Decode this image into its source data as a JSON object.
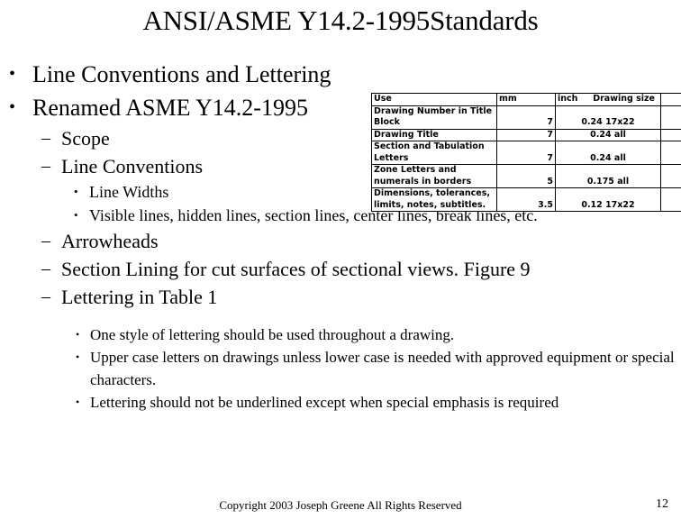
{
  "slide": {
    "title": "ANSI/ASME Y14.2-1995Standards",
    "page_number": "12",
    "copyright": "Copyright 2003 Joseph Greene All Rights Reserved"
  },
  "bullets": {
    "marker_level1": "•",
    "marker_level2": "–",
    "marker_level3": "•",
    "marker_level4": "•",
    "items": [
      {
        "level": 1,
        "text": "Line Conventions and Lettering"
      },
      {
        "level": 1,
        "text": "Renamed ASME Y14.2-1995"
      },
      {
        "level": 2,
        "text": "Scope"
      },
      {
        "level": 2,
        "text": "Line Conventions"
      },
      {
        "level": 3,
        "text": "Line Widths"
      },
      {
        "level": 3,
        "text": "Visible lines, hidden lines, section lines, center lines, break lines, etc."
      },
      {
        "level": 2,
        "text": "Arrowheads"
      },
      {
        "level": 2,
        "text": "Section Lining for cut surfaces of sectional views. Figure 9"
      },
      {
        "level": 2,
        "text": "Lettering in Table 1"
      },
      {
        "level": 4,
        "text": "One style of lettering should be used throughout a drawing."
      },
      {
        "level": 4,
        "text": "Upper case letters on drawings unless lower case is needed with approved equipment or special characters."
      },
      {
        "level": 4,
        "text": "Lettering should not be underlined except when special emphasis is required"
      }
    ]
  },
  "table": {
    "headers": {
      "use": "Use",
      "mm": "mm",
      "inch": "inch",
      "drawing_size": "Drawing size",
      "extra": ""
    },
    "rows": [
      {
        "use_line1": "Drawing Number in Title",
        "use_line2": "Block",
        "mm": "7",
        "inch": "0.24 17x22",
        "extra": ""
      },
      {
        "use_line1": "Drawing Title",
        "use_line2": "",
        "mm": "7",
        "inch": "0.24 all",
        "extra": ""
      },
      {
        "use_line1": "Section and Tabulation",
        "use_line2": "Letters",
        "mm": "7",
        "inch": "0.24 all",
        "extra": ""
      },
      {
        "use_line1": "Zone Letters and",
        "use_line2": "numerals in borders",
        "mm": "5",
        "inch": "0.175 all",
        "extra": ""
      },
      {
        "use_line1": "Dimensions, tolerances,",
        "use_line2": "limits, notes, subtitles.",
        "mm": "3.5",
        "inch": "0.12 17x22",
        "extra": ""
      }
    ]
  }
}
